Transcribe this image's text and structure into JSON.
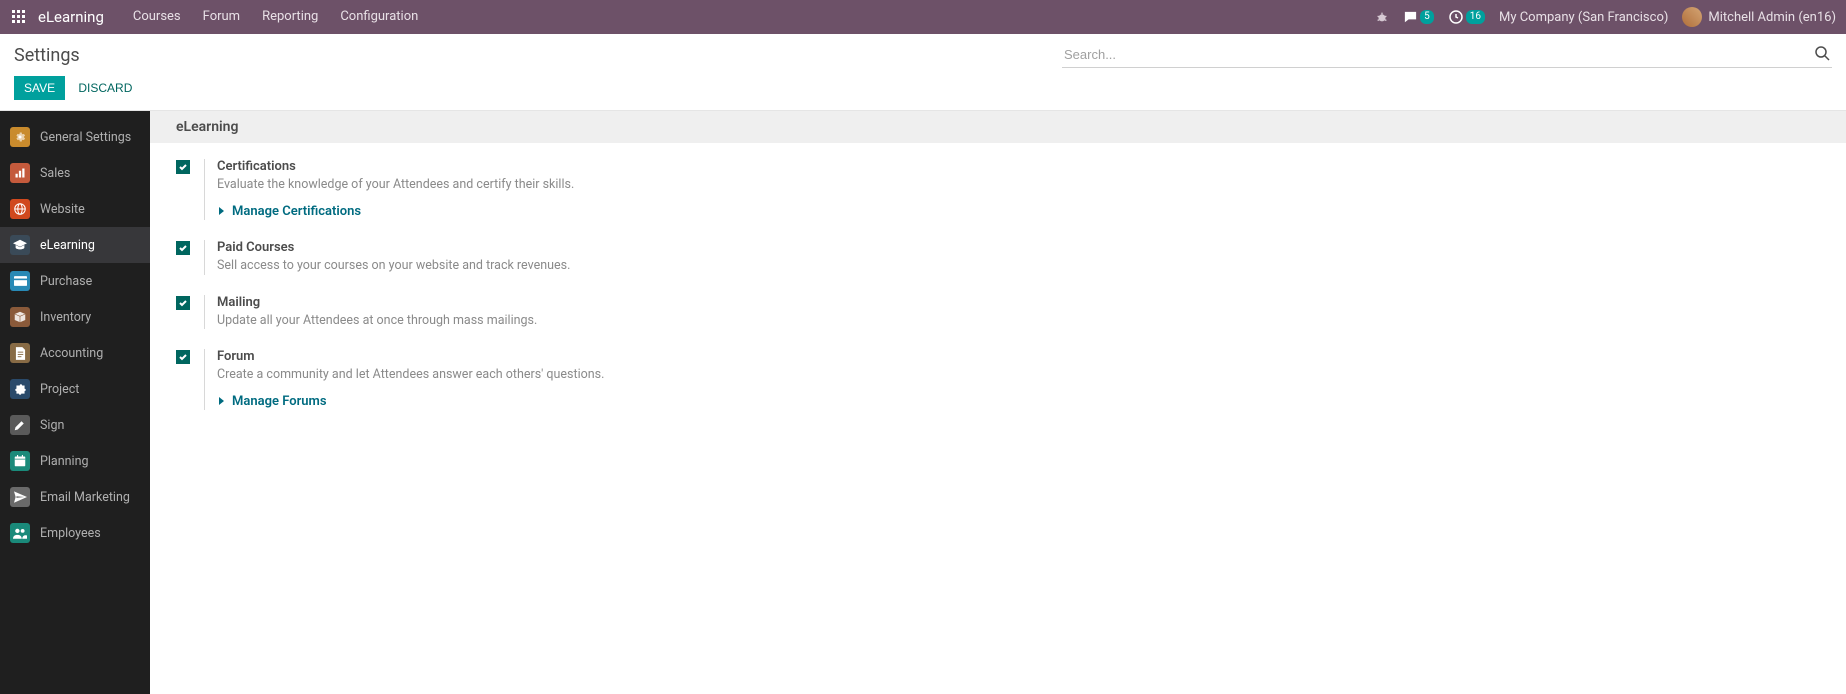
{
  "nav": {
    "brand": "eLearning",
    "menu": [
      "Courses",
      "Forum",
      "Reporting",
      "Configuration"
    ],
    "chat_badge": "5",
    "clock_badge": "16",
    "company": "My Company (San Francisco)",
    "user": "Mitchell Admin (en16)"
  },
  "page_title": "Settings",
  "search_placeholder": "Search...",
  "actions": {
    "save": "SAVE",
    "discard": "DISCARD"
  },
  "sidebar": [
    {
      "icon": "gear",
      "bg": "#c98b2d",
      "label": "General Settings"
    },
    {
      "icon": "chart",
      "bg": "#c45a3c",
      "label": "Sales"
    },
    {
      "icon": "globe",
      "bg": "#d0491e",
      "label": "Website"
    },
    {
      "icon": "grad",
      "bg": "#3a4a58",
      "label": "eLearning",
      "active": true
    },
    {
      "icon": "card",
      "bg": "#2889b5",
      "label": "Purchase"
    },
    {
      "icon": "box",
      "bg": "#8a5a3a",
      "label": "Inventory"
    },
    {
      "icon": "doc",
      "bg": "#886b45",
      "label": "Accounting"
    },
    {
      "icon": "puzzle",
      "bg": "#2a4a6a",
      "label": "Project"
    },
    {
      "icon": "pen",
      "bg": "#5a5a5a",
      "label": "Sign"
    },
    {
      "icon": "calendar",
      "bg": "#1a8a7a",
      "label": "Planning"
    },
    {
      "icon": "send",
      "bg": "#6a6a6a",
      "label": "Email Marketing"
    },
    {
      "icon": "people",
      "bg": "#1a8a7a",
      "label": "Employees"
    }
  ],
  "section_title": "eLearning",
  "settings": [
    {
      "checked": true,
      "title": "Certifications",
      "desc": "Evaluate the knowledge of your Attendees and certify their skills.",
      "link": "Manage Certifications"
    },
    {
      "checked": true,
      "title": "Paid Courses",
      "desc": "Sell access to your courses on your website and track revenues."
    },
    {
      "checked": true,
      "title": "Mailing",
      "desc": "Update all your Attendees at once through mass mailings."
    },
    {
      "checked": true,
      "title": "Forum",
      "desc": "Create a community and let Attendees answer each others' questions.",
      "link": "Manage Forums"
    }
  ]
}
